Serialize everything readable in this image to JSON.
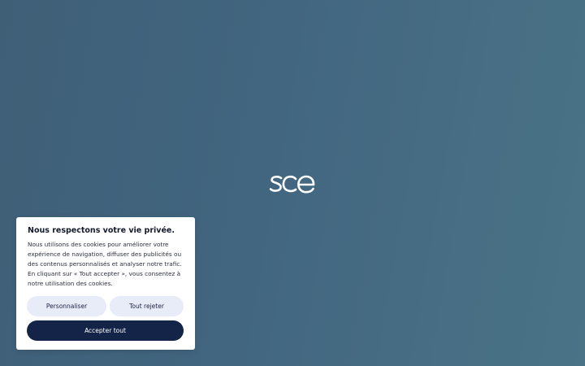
{
  "brand": {
    "logo_text": "sce"
  },
  "colors": {
    "background_start": "#3f5f77",
    "background_end": "#4a7386",
    "card_background": "#ffffff",
    "primary_button": "#132448",
    "secondary_button": "#e8ebf8"
  },
  "cookie_banner": {
    "title": "Nous respectons votre vie privée.",
    "body": "Nous utilisons des cookies pour améliorer votre expérience de navigation, diffuser des publicités ou des contenus personnalisés et analyser notre trafic. En cliquant sur « Tout accepter », vous consentez à notre utilisation des cookies.",
    "customize_label": "Personnaliser",
    "reject_label": "Tout rejeter",
    "accept_label": "Accepter tout"
  }
}
